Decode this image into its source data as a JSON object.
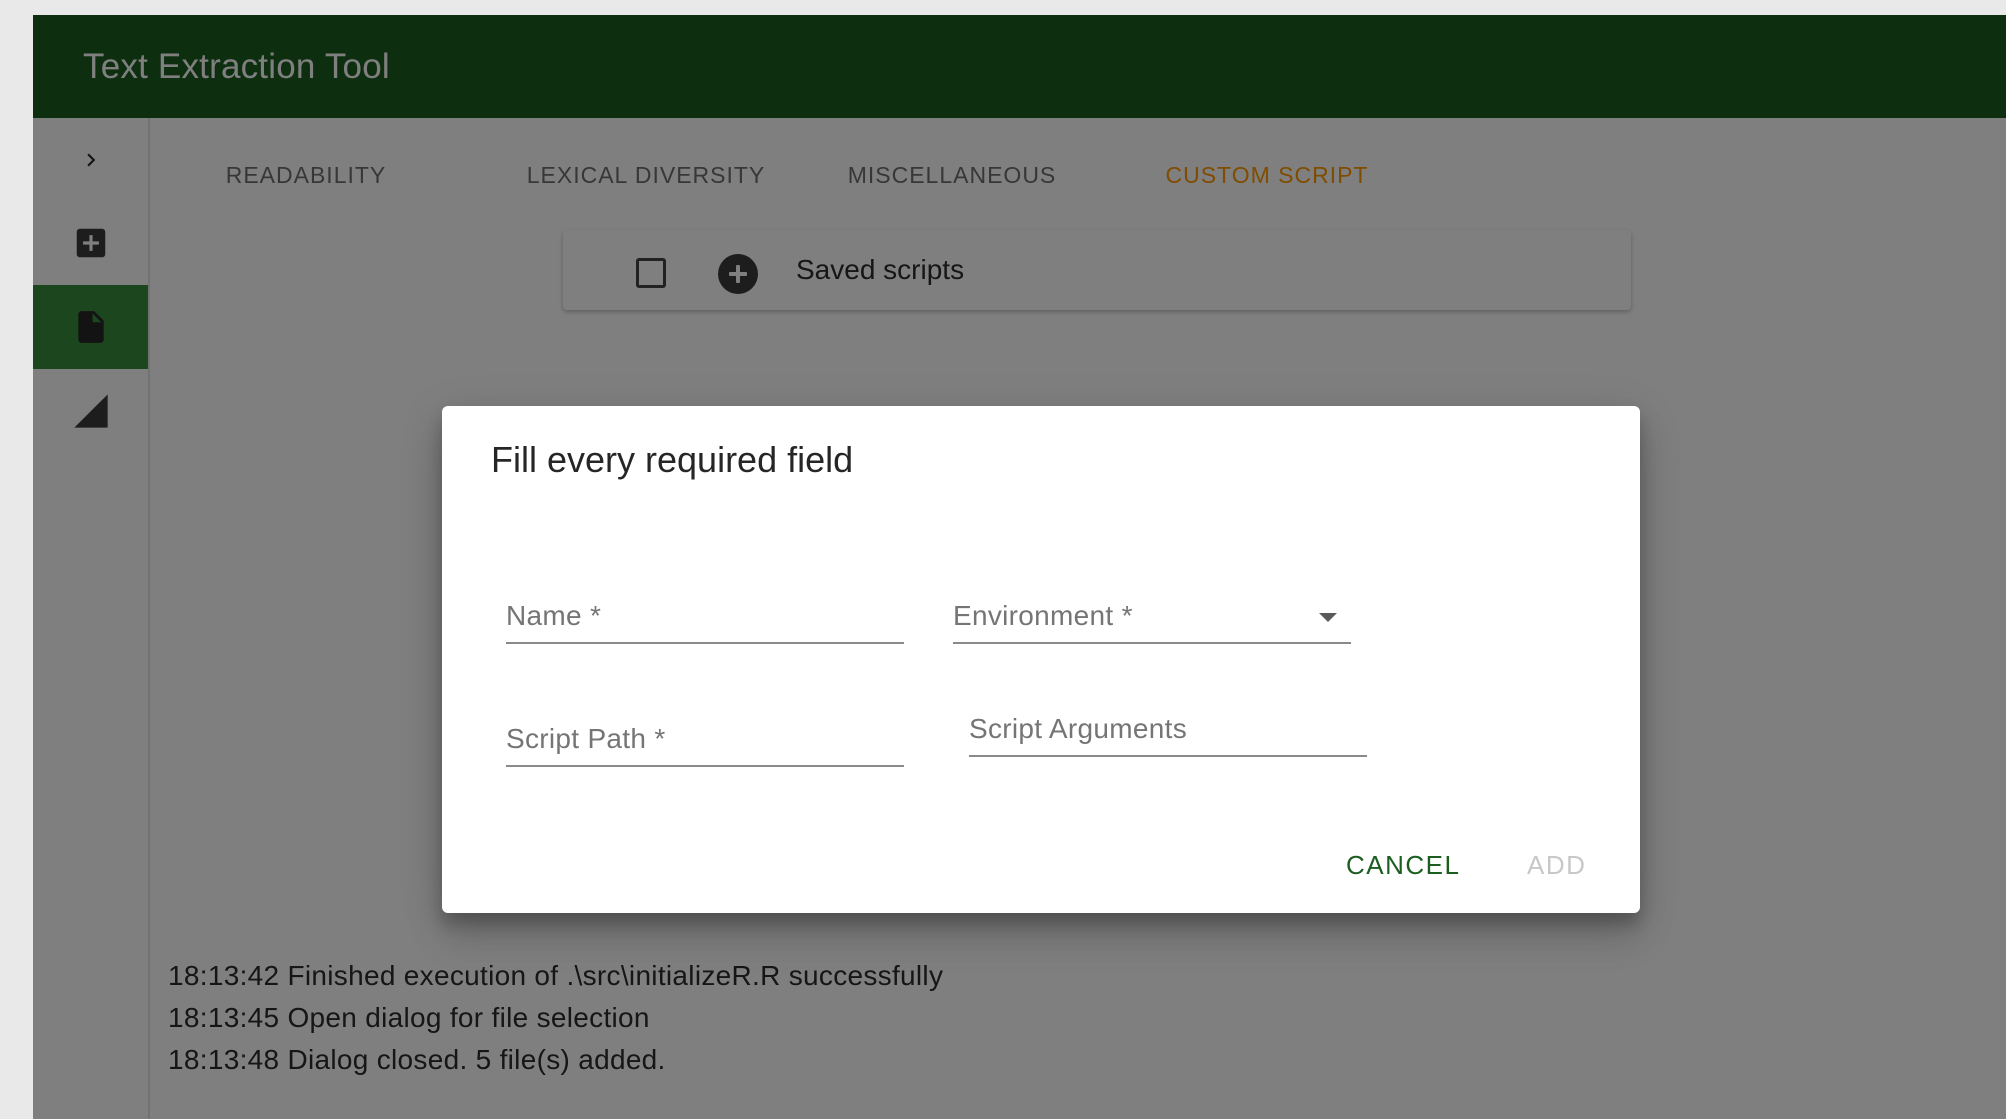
{
  "app": {
    "title": "Text Extraction Tool"
  },
  "nav_rail": {
    "items": [
      {
        "icon": "chevron-right-icon",
        "active": false
      },
      {
        "icon": "add-box-icon",
        "active": false
      },
      {
        "icon": "file-icon",
        "active": true
      },
      {
        "icon": "signal-icon",
        "active": false
      }
    ]
  },
  "tabs": [
    {
      "label": "READABILITY"
    },
    {
      "label": "LEXICAL DIVERSITY"
    },
    {
      "label": "MISCELLANEOUS"
    },
    {
      "label": "CUSTOM SCRIPT",
      "active": true
    }
  ],
  "saved_scripts": {
    "label": "Saved scripts",
    "checked": false
  },
  "dialog": {
    "title": "Fill every required field",
    "fields": {
      "name": {
        "label": "Name *",
        "value": ""
      },
      "environment": {
        "label": "Environment *",
        "value": ""
      },
      "script_path": {
        "label": "Script Path *",
        "value": ""
      },
      "script_arguments": {
        "label": "Script Arguments",
        "value": ""
      }
    },
    "cancel_label": "CANCEL",
    "add_label": "ADD"
  },
  "log": [
    "18:13:42 Finished execution of .\\src\\initializeR.R successfully",
    "18:13:45 Open dialog for file selection",
    "18:13:48 Dialog closed. 5 file(s) added."
  ],
  "colors": {
    "primary": "#1b5e20",
    "active_rail": "#388e3c",
    "accent": "#ff9800",
    "overlay": "rgba(0,0,0,0.5)"
  }
}
